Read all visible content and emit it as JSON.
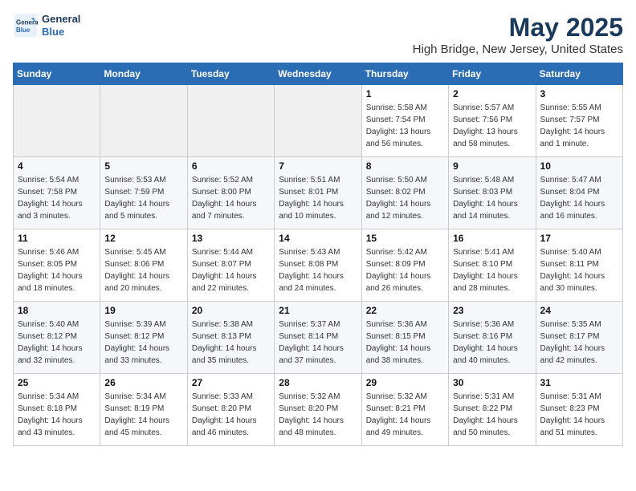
{
  "header": {
    "logo_line1": "General",
    "logo_line2": "Blue",
    "title": "May 2025",
    "subtitle": "High Bridge, New Jersey, United States"
  },
  "columns": [
    "Sunday",
    "Monday",
    "Tuesday",
    "Wednesday",
    "Thursday",
    "Friday",
    "Saturday"
  ],
  "weeks": [
    [
      {
        "day": "",
        "info": ""
      },
      {
        "day": "",
        "info": ""
      },
      {
        "day": "",
        "info": ""
      },
      {
        "day": "",
        "info": ""
      },
      {
        "day": "1",
        "info": "Sunrise: 5:58 AM\nSunset: 7:54 PM\nDaylight: 13 hours\nand 56 minutes."
      },
      {
        "day": "2",
        "info": "Sunrise: 5:57 AM\nSunset: 7:56 PM\nDaylight: 13 hours\nand 58 minutes."
      },
      {
        "day": "3",
        "info": "Sunrise: 5:55 AM\nSunset: 7:57 PM\nDaylight: 14 hours\nand 1 minute."
      }
    ],
    [
      {
        "day": "4",
        "info": "Sunrise: 5:54 AM\nSunset: 7:58 PM\nDaylight: 14 hours\nand 3 minutes."
      },
      {
        "day": "5",
        "info": "Sunrise: 5:53 AM\nSunset: 7:59 PM\nDaylight: 14 hours\nand 5 minutes."
      },
      {
        "day": "6",
        "info": "Sunrise: 5:52 AM\nSunset: 8:00 PM\nDaylight: 14 hours\nand 7 minutes."
      },
      {
        "day": "7",
        "info": "Sunrise: 5:51 AM\nSunset: 8:01 PM\nDaylight: 14 hours\nand 10 minutes."
      },
      {
        "day": "8",
        "info": "Sunrise: 5:50 AM\nSunset: 8:02 PM\nDaylight: 14 hours\nand 12 minutes."
      },
      {
        "day": "9",
        "info": "Sunrise: 5:48 AM\nSunset: 8:03 PM\nDaylight: 14 hours\nand 14 minutes."
      },
      {
        "day": "10",
        "info": "Sunrise: 5:47 AM\nSunset: 8:04 PM\nDaylight: 14 hours\nand 16 minutes."
      }
    ],
    [
      {
        "day": "11",
        "info": "Sunrise: 5:46 AM\nSunset: 8:05 PM\nDaylight: 14 hours\nand 18 minutes."
      },
      {
        "day": "12",
        "info": "Sunrise: 5:45 AM\nSunset: 8:06 PM\nDaylight: 14 hours\nand 20 minutes."
      },
      {
        "day": "13",
        "info": "Sunrise: 5:44 AM\nSunset: 8:07 PM\nDaylight: 14 hours\nand 22 minutes."
      },
      {
        "day": "14",
        "info": "Sunrise: 5:43 AM\nSunset: 8:08 PM\nDaylight: 14 hours\nand 24 minutes."
      },
      {
        "day": "15",
        "info": "Sunrise: 5:42 AM\nSunset: 8:09 PM\nDaylight: 14 hours\nand 26 minutes."
      },
      {
        "day": "16",
        "info": "Sunrise: 5:41 AM\nSunset: 8:10 PM\nDaylight: 14 hours\nand 28 minutes."
      },
      {
        "day": "17",
        "info": "Sunrise: 5:40 AM\nSunset: 8:11 PM\nDaylight: 14 hours\nand 30 minutes."
      }
    ],
    [
      {
        "day": "18",
        "info": "Sunrise: 5:40 AM\nSunset: 8:12 PM\nDaylight: 14 hours\nand 32 minutes."
      },
      {
        "day": "19",
        "info": "Sunrise: 5:39 AM\nSunset: 8:12 PM\nDaylight: 14 hours\nand 33 minutes."
      },
      {
        "day": "20",
        "info": "Sunrise: 5:38 AM\nSunset: 8:13 PM\nDaylight: 14 hours\nand 35 minutes."
      },
      {
        "day": "21",
        "info": "Sunrise: 5:37 AM\nSunset: 8:14 PM\nDaylight: 14 hours\nand 37 minutes."
      },
      {
        "day": "22",
        "info": "Sunrise: 5:36 AM\nSunset: 8:15 PM\nDaylight: 14 hours\nand 38 minutes."
      },
      {
        "day": "23",
        "info": "Sunrise: 5:36 AM\nSunset: 8:16 PM\nDaylight: 14 hours\nand 40 minutes."
      },
      {
        "day": "24",
        "info": "Sunrise: 5:35 AM\nSunset: 8:17 PM\nDaylight: 14 hours\nand 42 minutes."
      }
    ],
    [
      {
        "day": "25",
        "info": "Sunrise: 5:34 AM\nSunset: 8:18 PM\nDaylight: 14 hours\nand 43 minutes."
      },
      {
        "day": "26",
        "info": "Sunrise: 5:34 AM\nSunset: 8:19 PM\nDaylight: 14 hours\nand 45 minutes."
      },
      {
        "day": "27",
        "info": "Sunrise: 5:33 AM\nSunset: 8:20 PM\nDaylight: 14 hours\nand 46 minutes."
      },
      {
        "day": "28",
        "info": "Sunrise: 5:32 AM\nSunset: 8:20 PM\nDaylight: 14 hours\nand 48 minutes."
      },
      {
        "day": "29",
        "info": "Sunrise: 5:32 AM\nSunset: 8:21 PM\nDaylight: 14 hours\nand 49 minutes."
      },
      {
        "day": "30",
        "info": "Sunrise: 5:31 AM\nSunset: 8:22 PM\nDaylight: 14 hours\nand 50 minutes."
      },
      {
        "day": "31",
        "info": "Sunrise: 5:31 AM\nSunset: 8:23 PM\nDaylight: 14 hours\nand 51 minutes."
      }
    ]
  ]
}
